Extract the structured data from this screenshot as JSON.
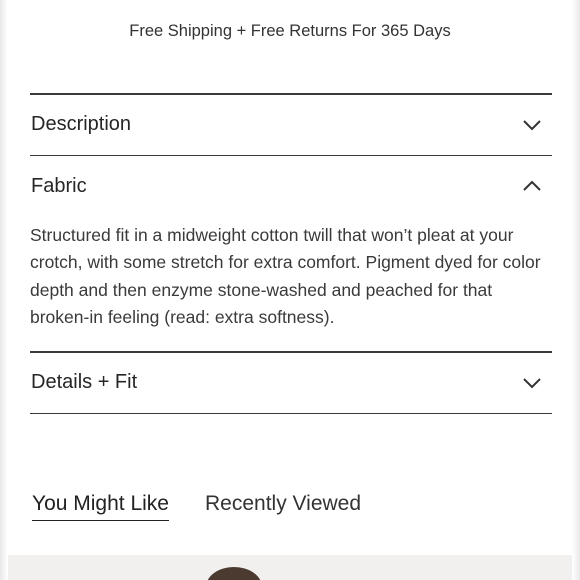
{
  "shipping_banner": "Free Shipping + Free Returns For 365 Days",
  "accordion": [
    {
      "title": "Description",
      "expanded": false,
      "icon": "chevron-down-icon"
    },
    {
      "title": "Fabric",
      "expanded": true,
      "icon": "chevron-up-icon",
      "body": "Structured fit in a midweight cotton twill that won’t pleat at your crotch, with some stretch for extra comfort. Pigment dyed for color depth and then enzyme stone-washed and peached for that broken-in feeling (read: extra softness)."
    },
    {
      "title": "Details + Fit",
      "expanded": false,
      "icon": "chevron-down-icon"
    }
  ],
  "tabs": [
    {
      "label": "You Might Like",
      "active": true
    },
    {
      "label": "Recently Viewed",
      "active": false
    }
  ],
  "colors": {
    "divider": "#3a3a3a",
    "text": "#262626",
    "strip": "#f1f0ee"
  }
}
